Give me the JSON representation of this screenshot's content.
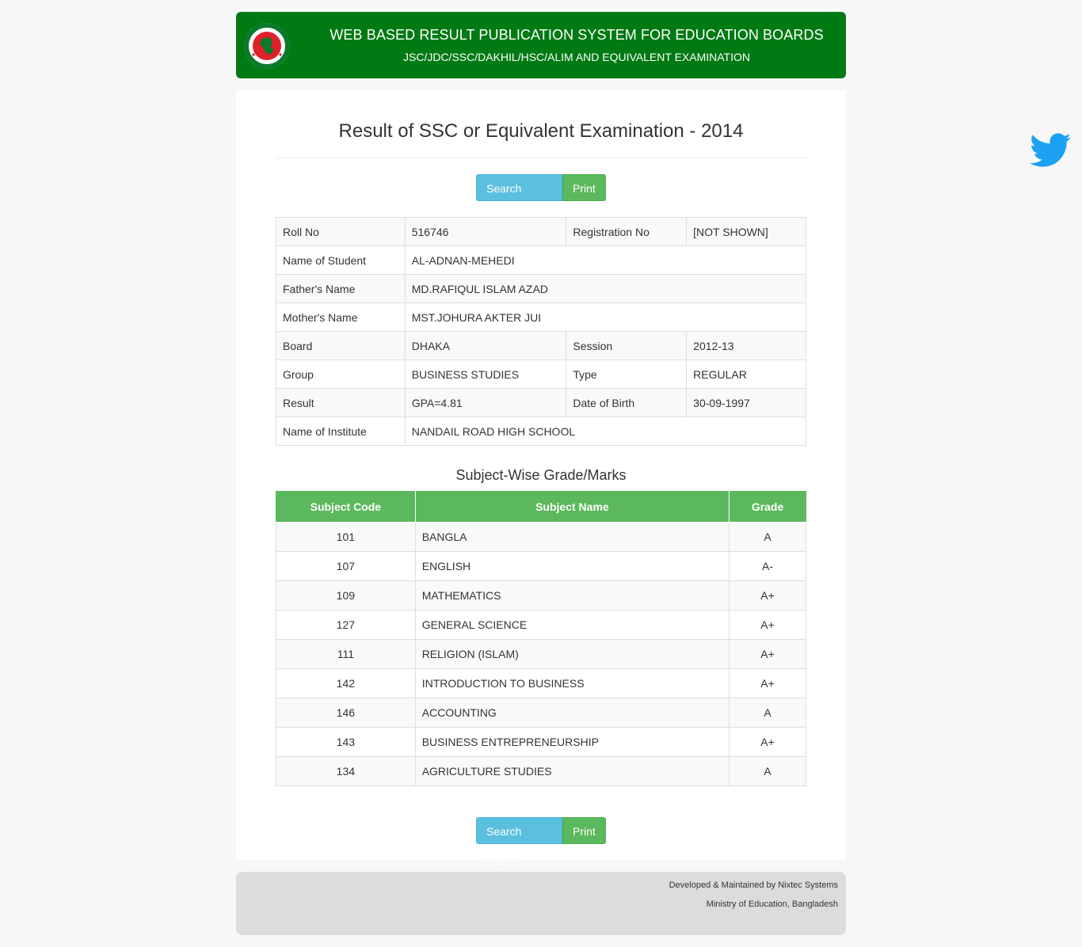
{
  "header": {
    "title": "WEB BASED RESULT PUBLICATION SYSTEM FOR EDUCATION BOARDS",
    "subtitle": "JSC/JDC/SSC/DAKHIL/HSC/ALIM AND EQUIVALENT EXAMINATION",
    "logo_icon": "bangladesh-government-seal-icon"
  },
  "page_title": "Result of SSC or Equivalent Examination - 2014",
  "buttons": {
    "search_again": "Search Again",
    "print": "Print"
  },
  "student": {
    "roll_label": "Roll No",
    "roll": "516746",
    "reg_label": "Registration No",
    "reg": "[NOT SHOWN]",
    "name_label": "Name of Student",
    "name": "AL-ADNAN-MEHEDI",
    "father_label": "Father's Name",
    "father": "MD.RAFIQUL ISLAM AZAD",
    "mother_label": "Mother's Name",
    "mother": "MST.JOHURA AKTER JUI",
    "board_label": "Board",
    "board": "DHAKA",
    "session_label": "Session",
    "session": "2012-13",
    "group_label": "Group",
    "group": "BUSINESS STUDIES",
    "type_label": "Type",
    "type": "REGULAR",
    "result_label": "Result",
    "result": "GPA=4.81",
    "dob_label": "Date of Birth",
    "dob": "30-09-1997",
    "institute_label": "Name of Institute",
    "institute": "NANDAIL ROAD HIGH SCHOOL"
  },
  "grades": {
    "heading": "Subject-Wise Grade/Marks",
    "columns": [
      "Subject Code",
      "Subject Name",
      "Grade"
    ],
    "rows": [
      {
        "code": "101",
        "name": "BANGLA",
        "grade": "A"
      },
      {
        "code": "107",
        "name": "ENGLISH",
        "grade": "A-"
      },
      {
        "code": "109",
        "name": "MATHEMATICS",
        "grade": "A+"
      },
      {
        "code": "127",
        "name": "GENERAL SCIENCE",
        "grade": "A+"
      },
      {
        "code": "111",
        "name": "RELIGION (ISLAM)",
        "grade": "A+"
      },
      {
        "code": "142",
        "name": "INTRODUCTION TO BUSINESS",
        "grade": "A+"
      },
      {
        "code": "146",
        "name": "ACCOUNTING",
        "grade": "A"
      },
      {
        "code": "143",
        "name": "BUSINESS ENTREPRENEURSHIP",
        "grade": "A+"
      },
      {
        "code": "134",
        "name": "AGRICULTURE STUDIES",
        "grade": "A"
      }
    ]
  },
  "footer": {
    "line1": "Developed & Maintained by Nixtec Systems",
    "line2": "Ministry of Education, Bangladesh"
  },
  "colors": {
    "header_green": "#007a12",
    "btn_info": "#5bc0de",
    "btn_success": "#5cb85c",
    "twitter_blue": "#1da1f2"
  },
  "social": {
    "twitter_icon": "twitter-bird-icon"
  }
}
